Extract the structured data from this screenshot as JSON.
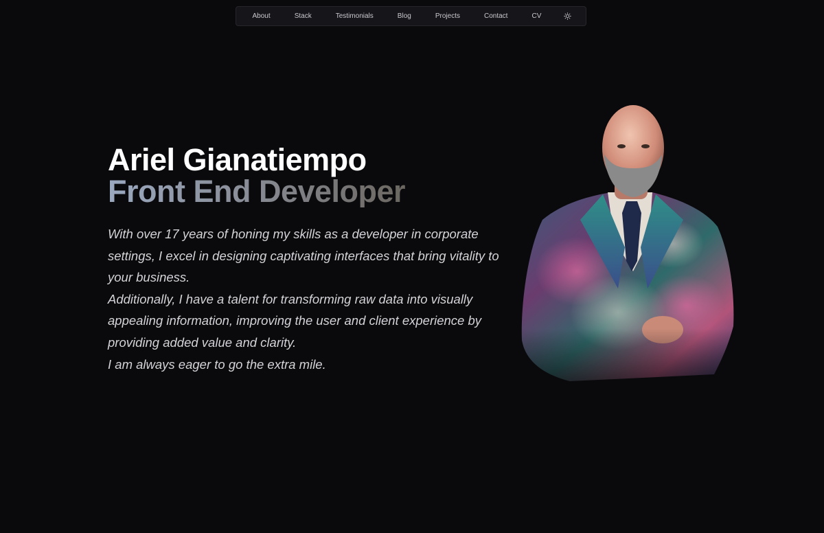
{
  "nav": {
    "items": [
      {
        "label": "About"
      },
      {
        "label": "Stack"
      },
      {
        "label": "Testimonials"
      },
      {
        "label": "Blog"
      },
      {
        "label": "Projects"
      },
      {
        "label": "Contact"
      },
      {
        "label": "CV"
      }
    ],
    "theme_toggle_icon": "sun-icon"
  },
  "hero": {
    "name": "Ariel Gianatiempo",
    "role": "Front End Developer",
    "bio": [
      "With over 17 years of honing my skills as a developer in corporate settings, I excel in designing captivating interfaces that bring vitality to your business.",
      "Additionally, I have a talent for transforming raw data into visually appealing information, improving the user and client experience by providing added value and clarity.",
      "I am always eager to go the extra mile."
    ]
  },
  "colors": {
    "background": "#0a0a0d",
    "nav_background": "#16161a",
    "heading": "#ffffff",
    "body_text": "#d4d4d8"
  }
}
